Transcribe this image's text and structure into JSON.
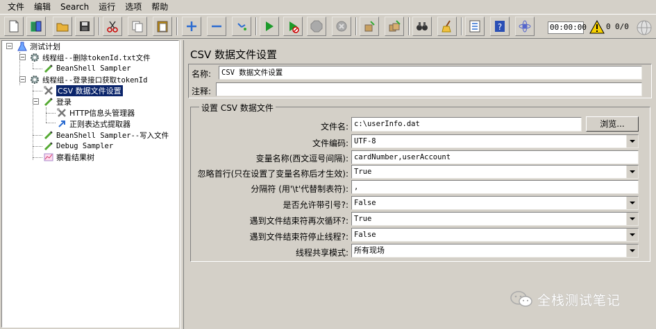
{
  "menu": [
    "文件",
    "编辑",
    "Search",
    "运行",
    "选项",
    "帮助"
  ],
  "toolbar": {
    "timer": "00:00:00",
    "error_count": "0",
    "thread_count": "0/0",
    "buttons": [
      "new-icon",
      "templates-icon",
      "open-icon",
      "save-icon",
      "cut-icon",
      "copy-icon",
      "paste-icon",
      "expand-icon",
      "collapse-icon",
      "toggle-icon",
      "start-icon",
      "start-no-pauses-icon",
      "stop-icon",
      "shutdown-icon",
      "clear-icon",
      "clear-all-icon",
      "search-icon",
      "reset-search-icon",
      "function-helper-icon",
      "help-icon",
      "remote-icon"
    ]
  },
  "tree": {
    "items": [
      {
        "label": "测试计划"
      },
      {
        "label": "线程组--删除tokenId.txt文件"
      },
      {
        "label": "BeanShell Sampler"
      },
      {
        "label": "线程组--登录接口获取tokenId"
      },
      {
        "label": "CSV 数据文件设置"
      },
      {
        "label": "登录"
      },
      {
        "label": "HTTP信息头管理器"
      },
      {
        "label": "正则表达式提取器"
      },
      {
        "label": "BeanShell Sampler--写入文件"
      },
      {
        "label": "Debug Sampler"
      },
      {
        "label": "察看结果树"
      }
    ],
    "selected_index": 4
  },
  "panel": {
    "title": "CSV 数据文件设置",
    "name_label": "名称:",
    "name_value": "CSV 数据文件设置",
    "comment_label": "注释:",
    "comment_value": "",
    "group_title": "设置 CSV 数据文件",
    "browse_label": "浏览...",
    "fields": [
      {
        "label": "文件名:",
        "value": "c:\\userInfo.dat",
        "kind": "text"
      },
      {
        "label": "文件编码:",
        "value": "UTF-8",
        "kind": "combo"
      },
      {
        "label": "变量名称(西文逗号间隔):",
        "value": "cardNumber,userAccount",
        "kind": "text"
      },
      {
        "label": "忽略首行(只在设置了变量名称后才生效):",
        "value": "True",
        "kind": "combo"
      },
      {
        "label": "分隔符 (用'\\t'代替制表符):",
        "value": ",",
        "kind": "text"
      },
      {
        "label": "是否允许带引号?:",
        "value": "False",
        "kind": "combo"
      },
      {
        "label": "遇到文件结束符再次循环?:",
        "value": "True",
        "kind": "combo"
      },
      {
        "label": "遇到文件结束符停止线程?:",
        "value": "False",
        "kind": "combo"
      },
      {
        "label": "线程共享模式:",
        "value": "所有现场",
        "kind": "combo"
      }
    ]
  },
  "watermark": "全栈测试笔记"
}
